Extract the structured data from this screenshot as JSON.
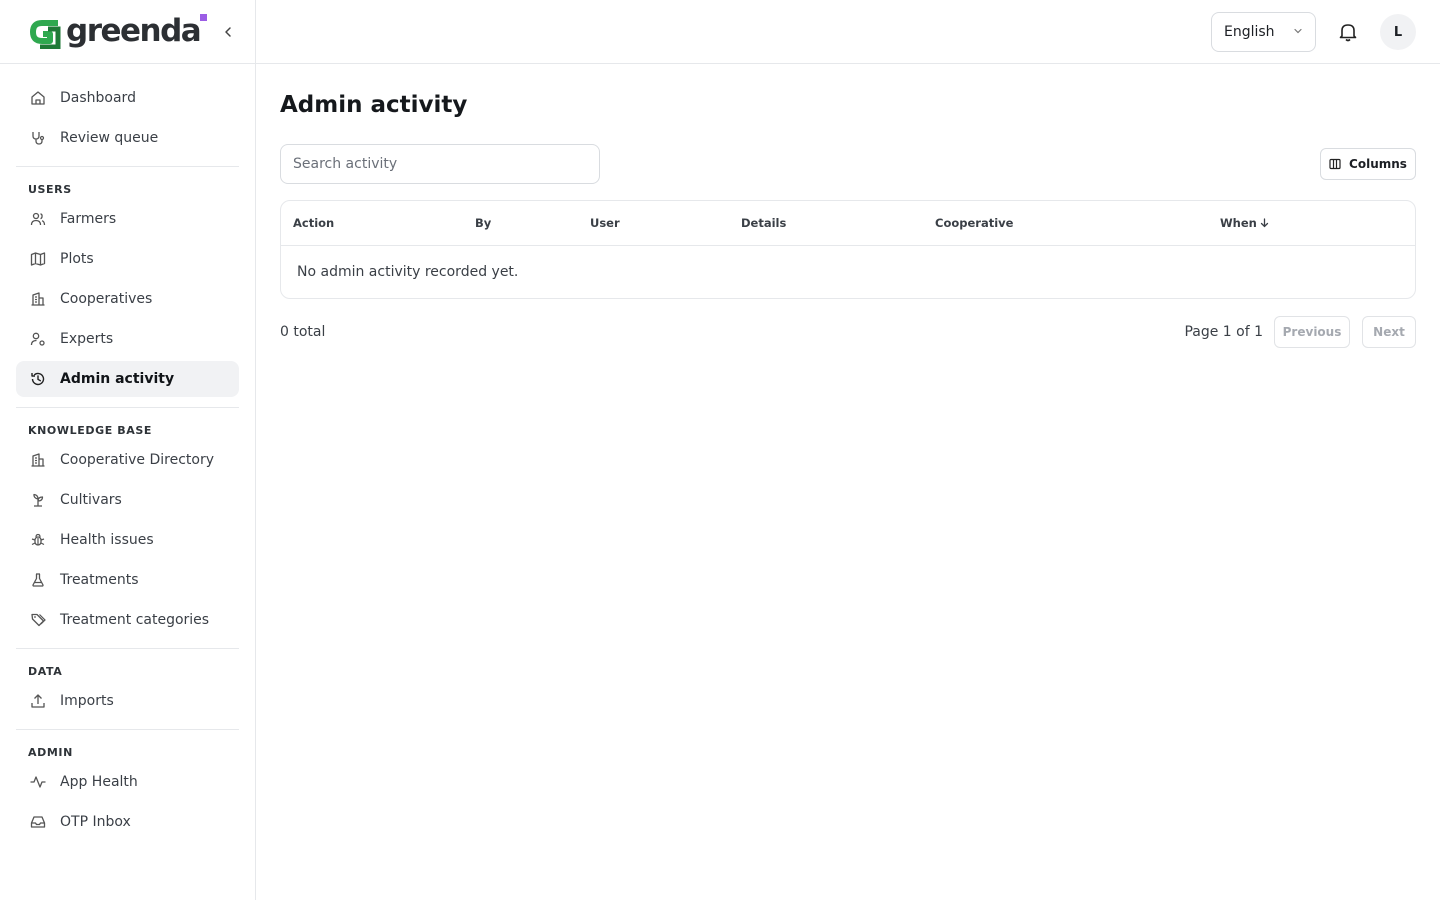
{
  "brand": {
    "name": "greenda"
  },
  "topbar": {
    "language": "English",
    "avatar_initial": "L"
  },
  "sidebar": {
    "primary": [
      {
        "label": "Dashboard",
        "icon": "home-icon"
      },
      {
        "label": "Review queue",
        "icon": "stethoscope-icon"
      }
    ],
    "sections": [
      {
        "heading": "USERS",
        "items": [
          {
            "label": "Farmers",
            "icon": "users-icon"
          },
          {
            "label": "Plots",
            "icon": "map-icon"
          },
          {
            "label": "Cooperatives",
            "icon": "building-icon"
          },
          {
            "label": "Experts",
            "icon": "user-cog-icon"
          },
          {
            "label": "Admin activity",
            "icon": "history-icon",
            "active": true
          }
        ]
      },
      {
        "heading": "KNOWLEDGE BASE",
        "items": [
          {
            "label": "Cooperative Directory",
            "icon": "building-icon"
          },
          {
            "label": "Cultivars",
            "icon": "sprout-icon"
          },
          {
            "label": "Health issues",
            "icon": "bug-icon"
          },
          {
            "label": "Treatments",
            "icon": "flask-icon"
          },
          {
            "label": "Treatment categories",
            "icon": "tags-icon"
          }
        ]
      },
      {
        "heading": "DATA",
        "items": [
          {
            "label": "Imports",
            "icon": "upload-icon"
          }
        ]
      },
      {
        "heading": "ADMIN",
        "items": [
          {
            "label": "App Health",
            "icon": "activity-icon"
          },
          {
            "label": "OTP Inbox",
            "icon": "inbox-icon"
          }
        ]
      }
    ]
  },
  "main": {
    "title": "Admin activity",
    "search_placeholder": "Search activity",
    "columns_label": "Columns",
    "table": {
      "headers": [
        "Action",
        "By",
        "User",
        "Details",
        "Cooperative",
        "When"
      ],
      "sort_column": "When",
      "sort_direction": "desc",
      "empty_message": "No admin activity recorded yet."
    },
    "footer": {
      "total": "0 total",
      "page_info": "Page 1 of 1",
      "previous_label": "Previous",
      "next_label": "Next"
    }
  },
  "colors": {
    "logo_green": "#2fa84f",
    "logo_accent": "#9b5de5",
    "active_bg": "#f1f2f4",
    "border": "#e6e8eb"
  }
}
